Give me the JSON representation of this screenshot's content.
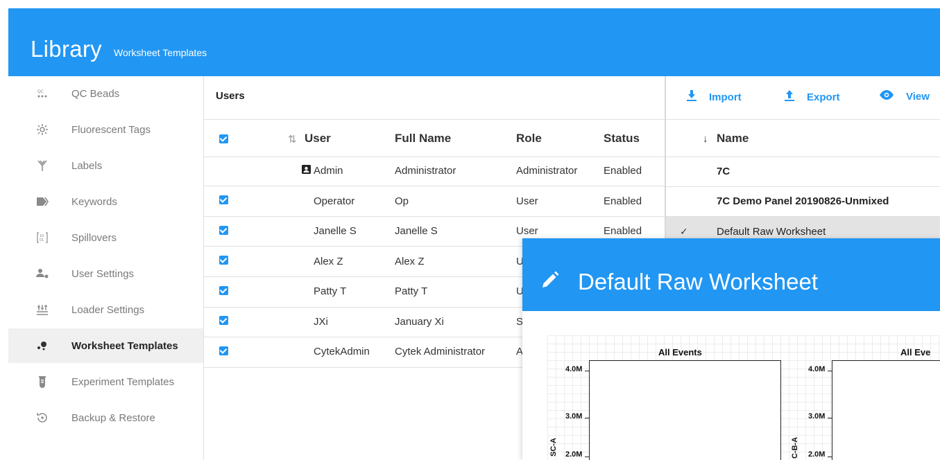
{
  "header": {
    "title": "Library",
    "subtitle": "Worksheet Templates"
  },
  "sidebar": {
    "items": [
      {
        "label": "QC Beads",
        "icon": "qc-beads-icon",
        "glyph": "⁘"
      },
      {
        "label": "Fluorescent Tags",
        "icon": "fluorescent-icon",
        "glyph": "☼"
      },
      {
        "label": "Labels",
        "icon": "labels-icon",
        "glyph": "Y"
      },
      {
        "label": "Keywords",
        "icon": "keywords-icon",
        "glyph": "⧫"
      },
      {
        "label": "Spillovers",
        "icon": "spillovers-icon",
        "glyph": "[⁚]"
      },
      {
        "label": "User Settings",
        "icon": "user-settings-icon",
        "glyph": "♟"
      },
      {
        "label": "Loader Settings",
        "icon": "loader-settings-icon",
        "glyph": "⩩"
      },
      {
        "label": "Worksheet Templates",
        "icon": "worksheet-templates-icon",
        "glyph": "•"
      },
      {
        "label": "Experiment Templates",
        "icon": "experiment-templates-icon",
        "glyph": "⚗"
      },
      {
        "label": "Backup & Restore",
        "icon": "backup-restore-icon",
        "glyph": "↺"
      }
    ],
    "active_index": 7
  },
  "users": {
    "title": "Users",
    "columns": {
      "user": "User",
      "full_name": "Full Name",
      "role": "Role",
      "status": "Status"
    },
    "rows": [
      {
        "user": "Admin",
        "full_name": "Administrator",
        "role": "Administrator",
        "status": "Enabled",
        "checked": false,
        "admin_icon": true
      },
      {
        "user": "Operator",
        "full_name": "Op",
        "role": "User",
        "status": "Enabled",
        "checked": true
      },
      {
        "user": "Janelle S",
        "full_name": "Janelle S",
        "role": "User",
        "status": "Enabled",
        "checked": true
      },
      {
        "user": "Alex Z",
        "full_name": "Alex Z",
        "role": "U",
        "status": "",
        "checked": true
      },
      {
        "user": "Patty T",
        "full_name": "Patty T",
        "role": "U",
        "status": "",
        "checked": true
      },
      {
        "user": "JXi",
        "full_name": "January Xi",
        "role": "S",
        "status": "",
        "checked": true
      },
      {
        "user": "CytekAdmin",
        "full_name": "Cytek Administrator",
        "role": "A",
        "status": "",
        "checked": true
      }
    ]
  },
  "toolbar": {
    "import_label": "Import",
    "export_label": "Export",
    "view_label": "View"
  },
  "templates": {
    "column": "Name",
    "sort_arrow": "↓",
    "rows": [
      {
        "name": "7C",
        "bold": true
      },
      {
        "name": "7C Demo Panel 20190826-Unmixed",
        "bold": true
      },
      {
        "name": "Default Raw Worksheet",
        "bold": false,
        "selected": true
      }
    ]
  },
  "worksheet": {
    "title": "Default Raw Worksheet",
    "plots": [
      {
        "title": "All Events",
        "y_label": "SC-A",
        "ticks": [
          "4.0M",
          "3.0M",
          "2.0M"
        ]
      },
      {
        "title": "All Eve",
        "y_label": "C-B-A",
        "ticks": [
          "4.0M",
          "3.0M",
          "2.0M"
        ]
      }
    ]
  },
  "colors": {
    "accent": "#2196f3",
    "active_bg": "#f0f0f0",
    "selected_row": "#e3e3e3"
  }
}
